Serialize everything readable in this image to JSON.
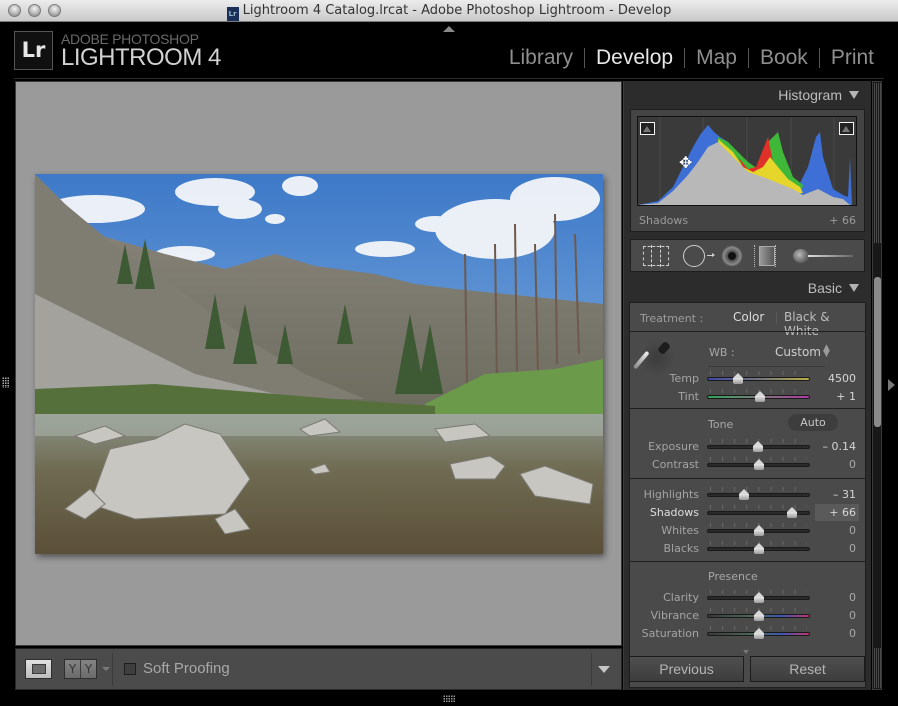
{
  "window": {
    "title": "Lightroom 4 Catalog.lrcat - Adobe Photoshop Lightroom - Develop",
    "doc_icon_text": "Lr"
  },
  "identity": {
    "logo": "Lr",
    "line1": "ADOBE PHOTOSHOP",
    "line2": "LIGHTROOM 4"
  },
  "modules": [
    {
      "label": "Library",
      "active": false
    },
    {
      "label": "Develop",
      "active": true
    },
    {
      "label": "Map",
      "active": false
    },
    {
      "label": "Book",
      "active": false
    },
    {
      "label": "Print",
      "active": false
    }
  ],
  "photo": {
    "subject": "mountain river canyon landscape"
  },
  "toolbar": {
    "yy_left": "Y",
    "yy_right": "Y",
    "soft_proofing_label": "Soft Proofing",
    "soft_proofing_checked": false
  },
  "histogram": {
    "title": "Histogram",
    "hover_label": "Shadows",
    "hover_value": "+ 66"
  },
  "basic": {
    "title": "Basic",
    "treatment_label": "Treatment :",
    "treatment_color": "Color",
    "treatment_bw": "Black & White",
    "wb_label": "WB :",
    "wb_value": "Custom",
    "tone_label": "Tone",
    "auto_label": "Auto",
    "presence_label": "Presence",
    "sliders": {
      "temp": {
        "label": "Temp",
        "value": "4500",
        "position": 0.29
      },
      "tint": {
        "label": "Tint",
        "value": "+ 1",
        "position": 0.505
      },
      "exposure": {
        "label": "Exposure",
        "value": "– 0.14",
        "position": 0.49
      },
      "contrast": {
        "label": "Contrast",
        "value": "0",
        "position": 0.5
      },
      "highlights": {
        "label": "Highlights",
        "value": "– 31",
        "position": 0.345
      },
      "shadows": {
        "label": "Shadows",
        "value": "+ 66",
        "position": 0.83
      },
      "whites": {
        "label": "Whites",
        "value": "0",
        "position": 0.5
      },
      "blacks": {
        "label": "Blacks",
        "value": "0",
        "position": 0.5
      },
      "clarity": {
        "label": "Clarity",
        "value": "0",
        "position": 0.5
      },
      "vibrance": {
        "label": "Vibrance",
        "value": "0",
        "position": 0.5
      },
      "saturation": {
        "label": "Saturation",
        "value": "0",
        "position": 0.5
      }
    }
  },
  "buttons": {
    "previous": "Previous",
    "reset": "Reset"
  },
  "colors": {
    "histogram_blue": "#3d6fd6",
    "histogram_yellow": "#e6d52a",
    "histogram_red": "#e0302a",
    "histogram_green": "#3fb83a",
    "histogram_gray": "#b8b8b8"
  }
}
